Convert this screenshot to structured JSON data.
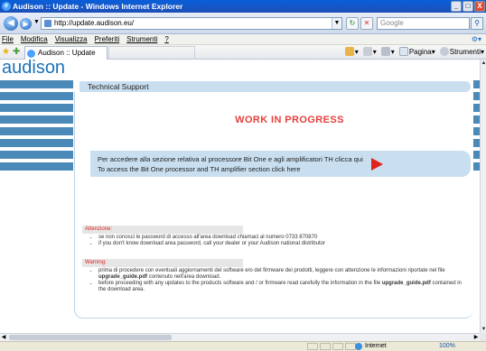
{
  "window": {
    "title": "Audison :: Update - Windows Internet Explorer",
    "controls": [
      "_",
      "□",
      "X"
    ]
  },
  "addressbar": {
    "url": "http://update.audison.eu/",
    "search_placeholder": "Google"
  },
  "menu": {
    "items": [
      "File",
      "Modifica",
      "Visualizza",
      "Preferiti",
      "Strumenti",
      "?"
    ]
  },
  "tab": {
    "label": "Audison :: Update"
  },
  "commandbar": {
    "page_label": "Pagina",
    "tools_label": "Strumenti"
  },
  "page": {
    "logo": "audison",
    "section_header": "Technical Support",
    "work_in_progress": "WORK IN PROGRESS",
    "bitone": {
      "line_it": "Per accedere alla sezione relativa al processore Bit One e agli amplificatori TH clicca qui",
      "line_en": "To access the Bit One processor and TH amplifier section click here"
    },
    "attention": {
      "heading": "Attenzione:",
      "items": [
        "se non conosci le password di accesso all'area download chiamaci al numero 0733 870870",
        "if you don't know download area password, call your dealer or your Audison national distributor"
      ]
    },
    "warning": {
      "heading": "Warning:",
      "item1_pre": "prima di procedere con eventuali aggiornamenti del software e/o del firmware dei prodotti, leggere con attenzione le informazioni riportate nel file ",
      "item1_file": "upgrade_guide.pdf",
      "item1_post": " contenuto nell'area download.",
      "item2_pre": "before proceeding with any updates to the products software and / or firmware read carefully the information in the file ",
      "item2_file": "upgrade_guide.pdf",
      "item2_post": " contained in the download area."
    }
  },
  "status": {
    "zone": "Internet",
    "zoom": "100%"
  },
  "colors": {
    "accent_blue": "#4a89b8",
    "header_bg": "#c9dff0",
    "alert_red": "#e5413c",
    "logo_blue": "#1b72b8"
  }
}
